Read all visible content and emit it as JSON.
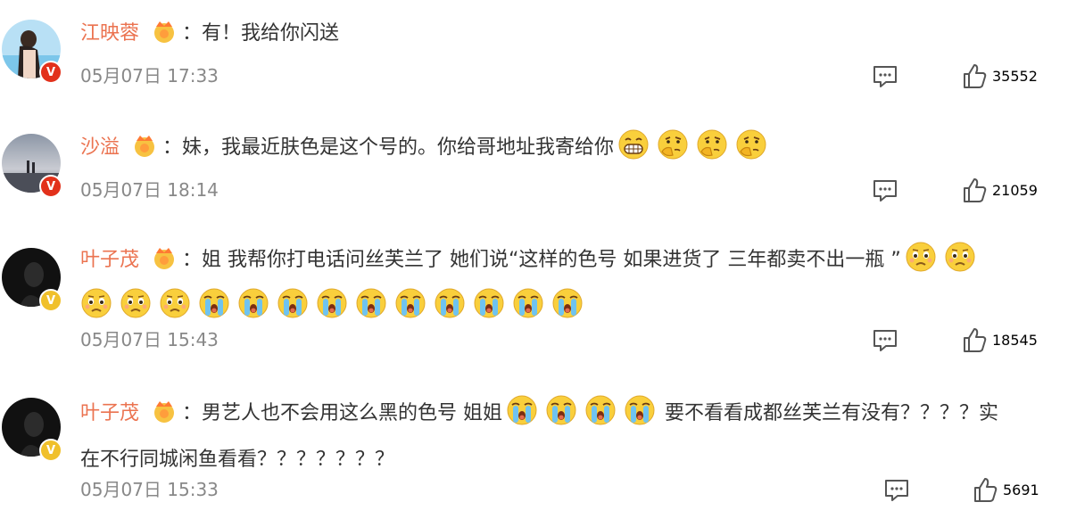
{
  "comments": [
    {
      "user": "江映蓉",
      "badge": "red",
      "text": "：有！我给你闪送",
      "text2": "",
      "emojis_inline": [],
      "emojis_line2": [],
      "time": "05月07日 17:33",
      "likes": "35552"
    },
    {
      "user": "沙溢",
      "badge": "red",
      "text": "：妹，我最近肤色是这个号的。你给哥地址我寄给你",
      "emojis_inline": [
        "grin-emoji",
        "think-emoji",
        "think-emoji",
        "think-emoji"
      ],
      "time": "05月07日 18:14",
      "likes": "21059"
    },
    {
      "user": "叶子茂",
      "badge": "gold",
      "text": "：姐 我帮你打电话问丝芙兰了 她们说“这样的色号 如果进货了 三年都卖不出一瓶 ”",
      "emojis_inline": [
        "sad-emoji",
        "sad-emoji"
      ],
      "emojis_line2": [
        "sad-emoji",
        "sad-emoji",
        "sad-emoji",
        "cry-emoji",
        "cry-emoji",
        "cry-emoji",
        "cry-emoji",
        "cry-emoji",
        "cry-emoji",
        "cry-emoji",
        "cry-emoji",
        "cry-emoji",
        "cry-emoji"
      ],
      "time": "05月07日 15:43",
      "likes": "18545"
    },
    {
      "user": "叶子茂",
      "badge": "gold",
      "text": "：男艺人也不会用这么黑的色号 姐姐",
      "emojis_inline": [
        "cry-emoji",
        "cry-emoji",
        "cry-emoji",
        "cry-emoji"
      ],
      "text_after": "要不看看成都丝芙兰有没有？？？？实",
      "text2": "在不行同城闲鱼看看？？？？？？？",
      "time": "05月07日 15:33",
      "likes": "5691"
    }
  ],
  "badge_glyph": "V",
  "colors": {
    "name": "#eb7350",
    "meta": "#888888",
    "text": "#333333"
  }
}
